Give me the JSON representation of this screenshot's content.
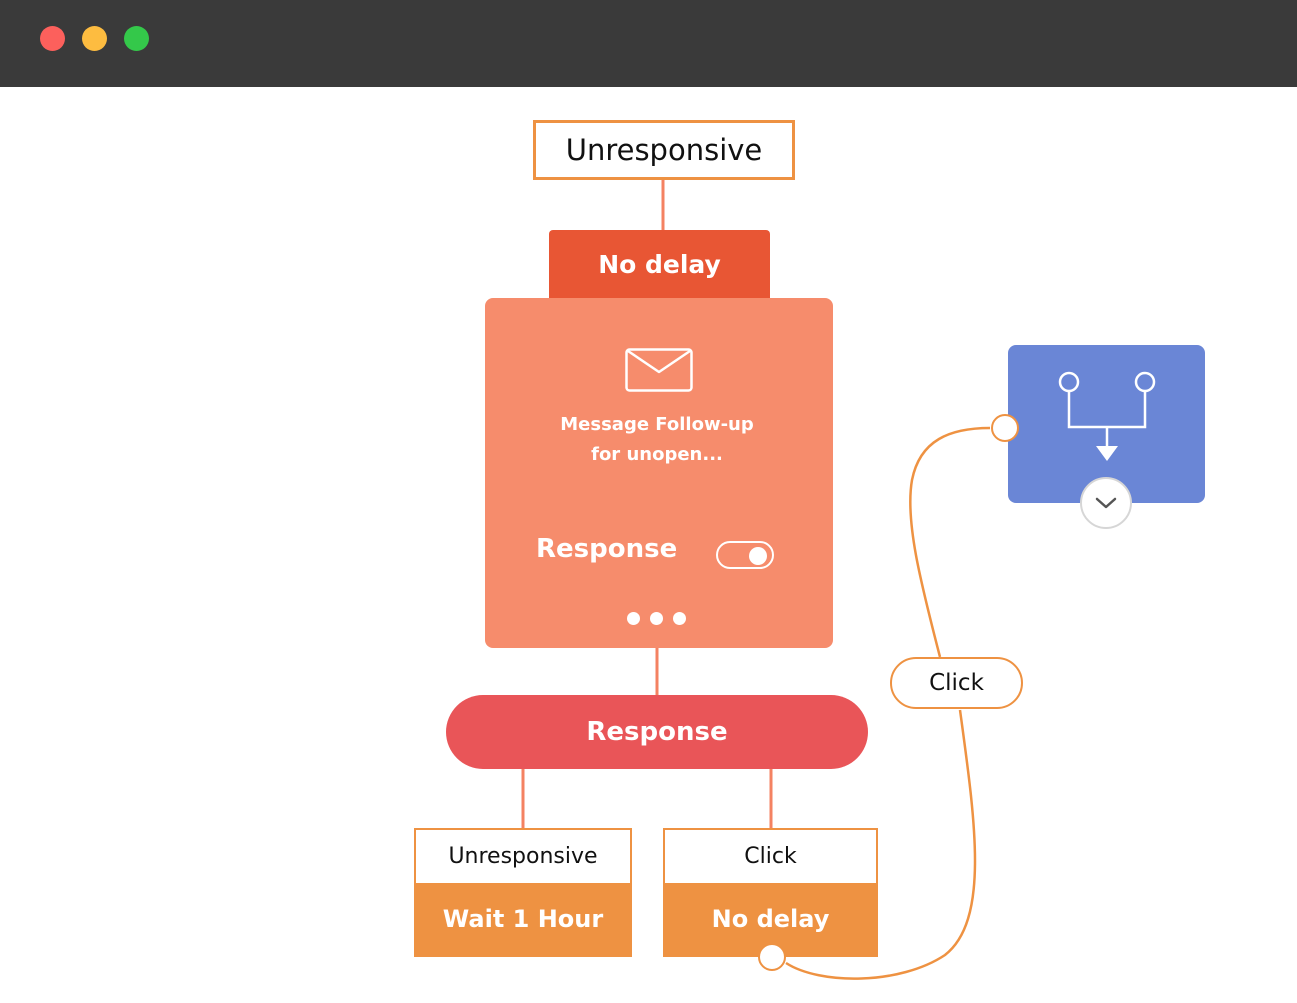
{
  "window": {
    "traffic_lights": [
      "close",
      "minimize",
      "zoom"
    ],
    "colors": {
      "close": "#fc605c",
      "minimize": "#fdbc40",
      "zoom": "#34c84a",
      "titlebar": "#3a3a3a"
    }
  },
  "flow": {
    "trigger": {
      "label": "Unresponsive"
    },
    "top_delay": {
      "label": "No delay",
      "color": "#e85634"
    },
    "message_card": {
      "icon": "envelope-icon",
      "title_line1": "Message Follow-up",
      "title_line2": "for unopen...",
      "response_label": "Response",
      "response_toggle_on": true,
      "more_icon": "more-dots-icon",
      "color": "#f68c6c"
    },
    "response_split": {
      "label": "Response",
      "color": "#e95558"
    },
    "branches": [
      {
        "condition": "Unresponsive",
        "delay": "Wait 1 Hour"
      },
      {
        "condition": "Click",
        "delay": "No delay"
      }
    ],
    "connector_label": "Click",
    "split_node": {
      "icon": "merge-split-icon",
      "expand_icon": "chevron-down-icon",
      "color": "#6a86d6"
    },
    "accent_color": "#ee9242"
  }
}
